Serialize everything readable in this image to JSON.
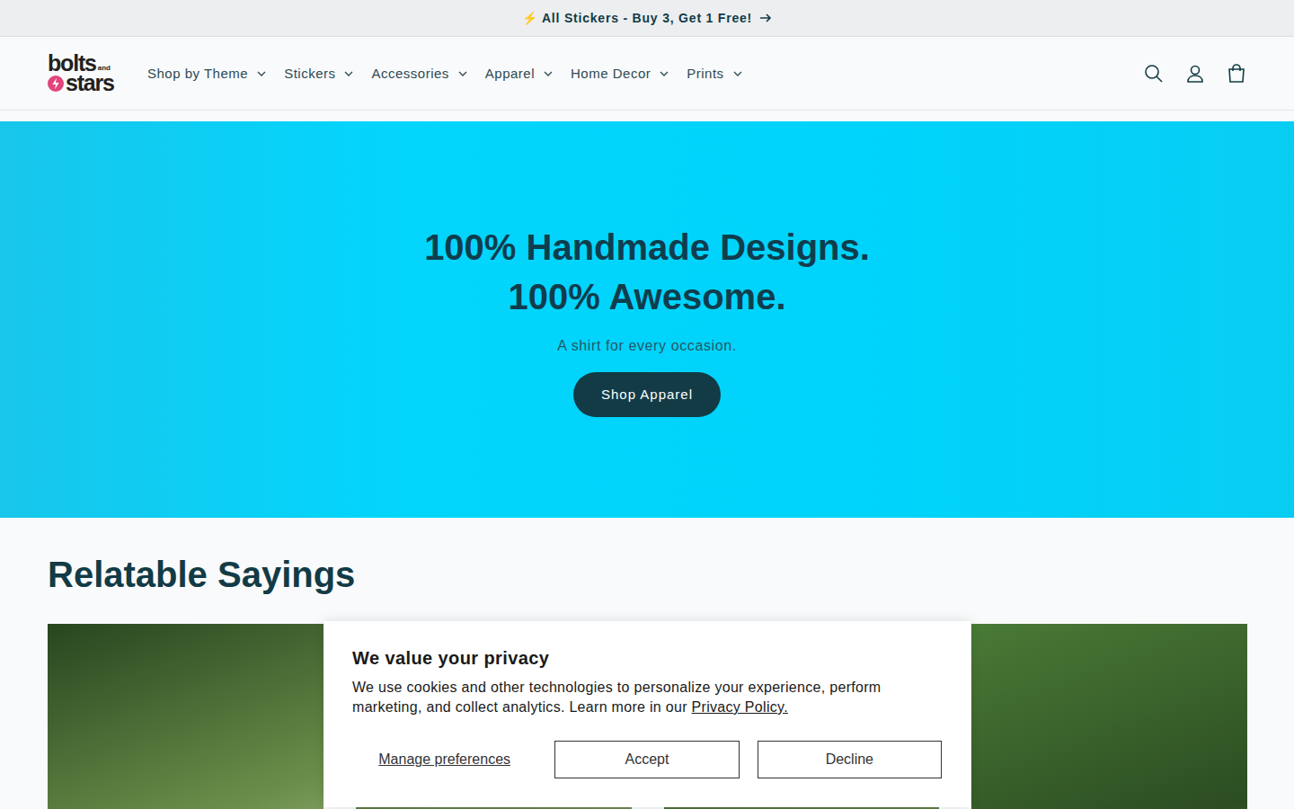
{
  "announcement": {
    "text": "⚡ All Stickers - Buy 3, Get 1 Free!"
  },
  "logo": {
    "top": "bolts",
    "small": "and",
    "bottom": "stars"
  },
  "nav": [
    {
      "label": "Shop by Theme"
    },
    {
      "label": "Stickers"
    },
    {
      "label": "Accessories"
    },
    {
      "label": "Apparel"
    },
    {
      "label": "Home Decor"
    },
    {
      "label": "Prints"
    }
  ],
  "hero": {
    "title_lines": [
      "100% Handmade Designs.",
      "100% Awesome."
    ],
    "subtitle": "A shirt for every occasion.",
    "button": "Shop Apparel"
  },
  "section": {
    "heading": "Relatable Sayings",
    "cards": [
      {
        "kind": "photo"
      },
      {
        "kind": "photo"
      },
      {
        "kind": "photo"
      },
      {
        "kind": "photo"
      }
    ]
  },
  "cookie_banner": {
    "title": "We value your privacy",
    "body": "We use cookies and other technologies to personalize your experience, perform marketing, and collect analytics. Learn more in our",
    "link": "Privacy Policy.",
    "buttons": [
      {
        "label": "Manage preferences",
        "kind": "link"
      },
      {
        "label": "Accept",
        "kind": "outline"
      },
      {
        "label": "Decline",
        "kind": "outline"
      }
    ]
  }
}
